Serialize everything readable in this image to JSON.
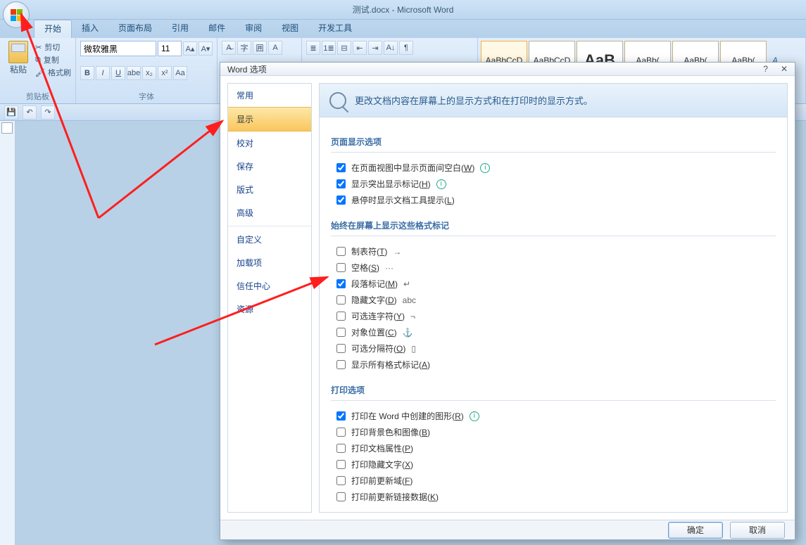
{
  "title": "测试.docx - Microsoft Word",
  "tabs": [
    "开始",
    "插入",
    "页面布局",
    "引用",
    "邮件",
    "审阅",
    "视图",
    "开发工具"
  ],
  "clipboard": {
    "cut": "剪切",
    "copy": "复制",
    "brush": "格式刷",
    "paste": "粘贴",
    "label": "剪贴板"
  },
  "font": {
    "name": "微软雅黑",
    "size": "11",
    "label": "字体"
  },
  "styles": [
    "AaBbCcD",
    "AaBbCcD",
    "AaB",
    "AaBb(",
    "AaBb(",
    "AaBb("
  ],
  "styles_trail": "A",
  "dialog": {
    "title": "Word 选项",
    "nav": [
      "常用",
      "显示",
      "校对",
      "保存",
      "版式",
      "高级",
      "自定义",
      "加载项",
      "信任中心",
      "资源"
    ],
    "headline": "更改文档内容在屏幕上的显示方式和在打印时的显示方式。",
    "sec1": "页面显示选项",
    "sec1_items": [
      {
        "label": "在页面视图中显示页面间空白(W)",
        "checked": true,
        "info": true
      },
      {
        "label": "显示突出显示标记(H)",
        "checked": true,
        "info": true
      },
      {
        "label": "悬停时显示文档工具提示(L)",
        "checked": true
      }
    ],
    "sec2": "始终在屏幕上显示这些格式标记",
    "sec2_items": [
      {
        "label": "制表符(T)",
        "sym": "→",
        "checked": false
      },
      {
        "label": "空格(S)",
        "sym": "···",
        "checked": false
      },
      {
        "label": "段落标记(M)",
        "sym": "↵",
        "checked": true
      },
      {
        "label": "隐藏文字(D)",
        "sym": "abc",
        "checked": false
      },
      {
        "label": "可选连字符(Y)",
        "sym": "¬",
        "checked": false
      },
      {
        "label": "对象位置(C)",
        "sym": "⚓",
        "checked": false
      },
      {
        "label": "可选分隔符(O)",
        "sym": "▯",
        "checked": false
      },
      {
        "label": "显示所有格式标记(A)",
        "sym": "",
        "checked": false
      }
    ],
    "sec3": "打印选项",
    "sec3_items": [
      {
        "label": "打印在 Word 中创建的图形(R)",
        "checked": true,
        "info": true
      },
      {
        "label": "打印背景色和图像(B)",
        "checked": false
      },
      {
        "label": "打印文档属性(P)",
        "checked": false
      },
      {
        "label": "打印隐藏文字(X)",
        "checked": false
      },
      {
        "label": "打印前更新域(F)",
        "checked": false
      },
      {
        "label": "打印前更新链接数据(K)",
        "checked": false
      }
    ],
    "ok": "确定",
    "cancel": "取消"
  }
}
